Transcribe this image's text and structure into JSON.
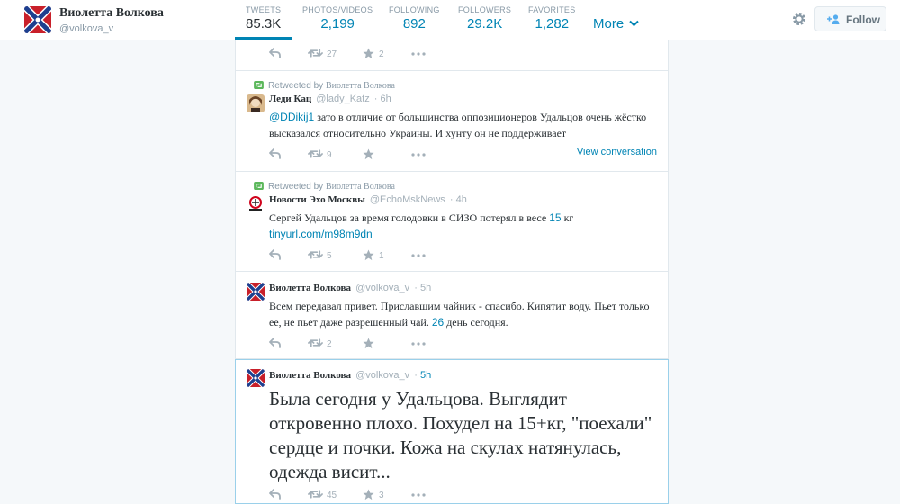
{
  "profile": {
    "name": "Виолетта Волкова",
    "handle": "@volkova_v",
    "stats": [
      {
        "label": "TWEETS",
        "value": "85.3K"
      },
      {
        "label": "PHOTOS/VIDEOS",
        "value": "2,199"
      },
      {
        "label": "FOLLOWING",
        "value": "892"
      },
      {
        "label": "FOLLOWERS",
        "value": "29.2K"
      },
      {
        "label": "FAVORITES",
        "value": "1,282"
      }
    ],
    "more_label": "More",
    "follow_label": "Follow"
  },
  "tweets": [
    {
      "retweets": "27",
      "favorites": "2"
    },
    {
      "retweeted_by_prefix": "Retweeted by",
      "retweeted_by_name": "Виолетта Волкова",
      "name": "Леди Кац",
      "handle": "@lady_Katz",
      "time": "6h",
      "mention": "@DDikij1",
      "text": "зато в отличие от большинства оппозиционеров Удальцов очень жёстко высказался относительно Украины. И хунту он не поддерживает",
      "view_conversation": "View conversation",
      "retweets": "9"
    },
    {
      "retweeted_by_prefix": "Retweeted by",
      "retweeted_by_name": "Виолетта Волкова",
      "name": "Новости Эхо Москвы",
      "handle": "@EchoMskNews",
      "time": "4h",
      "text_before": "Сергей Удальцов за время голодовки в СИЗО потерял в весе",
      "text_num": "15",
      "text_after": "кг",
      "link": "tinyurl.com/m98m9dn",
      "retweets": "5",
      "favorites": "1"
    },
    {
      "name": "Виолетта Волкова",
      "handle": "@volkova_v",
      "time": "5h",
      "text_before": "Всем передавал привет. Приславшим чайник - спасибо. Кипятит воду. Пьет только ее, не пьет даже разрешенный чай.",
      "text_num": "26",
      "text_after": "день сегодня.",
      "retweets": "2"
    },
    {
      "name": "Виолетта Волкова",
      "handle": "@volkova_v",
      "time": "5h",
      "text": "Была сегодня у Удальцова. Выглядит откровенно плохо. Похудел на 15+кг, \"поехали\" сердце и почки. Кожа на скулах натянулась, одежда висит...",
      "retweets": "45",
      "favorites": "3"
    }
  ]
}
